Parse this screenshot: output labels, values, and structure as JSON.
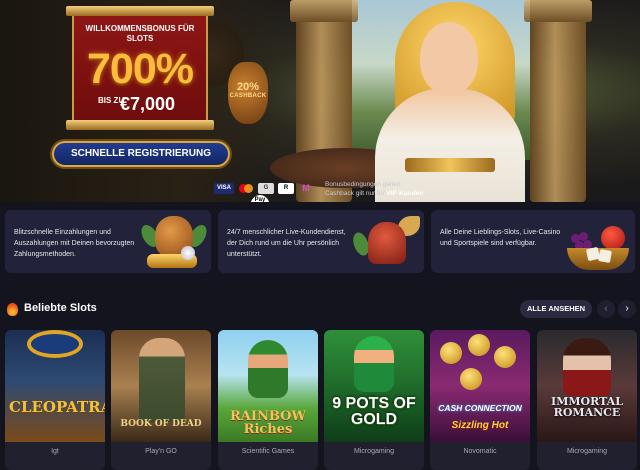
{
  "hero": {
    "bonus_title": "WILLKOMMENSBONUS FÜR SLOTS",
    "bonus_percent": "700%",
    "bonus_upto": "BIS ZU",
    "bonus_amount": "€7,000",
    "cashback_badge_percent": "20%",
    "cashback_badge_label": "CASHBACK",
    "register_button": "SCHNELLE REGISTRIERUNG",
    "payment_methods": [
      "VISA",
      "mastercard",
      "Apple Pay",
      "G",
      "R",
      "M"
    ],
    "terms_line1": "Bonusbedingungen gelten.",
    "terms_line2_prefix": "Cashback gilt nur für ",
    "terms_line2_bold": "VIP-Kunden",
    "terms_line2_suffix": "."
  },
  "features": [
    {
      "text": "Blitzschnelle Einzahlungen und Auszahlungen mit Deinen bevorzugten Zahlungsmethoden.",
      "icon": "amphora-coins-icon"
    },
    {
      "text": "24/7 menschlicher Live-Kundendienst, der Dich rund um die Uhr persönlich unterstützt.",
      "icon": "winged-helmet-icon"
    },
    {
      "text": "Alle Deine Lieblings-Slots, Live-Casino und Sportspiele sind verfügbar.",
      "icon": "fruit-bowl-dice-icon"
    }
  ],
  "section": {
    "title": "Beliebte Slots",
    "icon": "fire-icon",
    "see_all": "ALLE ANSEHEN",
    "prev_icon": "‹",
    "next_icon": "›"
  },
  "games": [
    {
      "title": "CLEOPATRA",
      "provider": "Igt"
    },
    {
      "title": "BOOK OF DEAD",
      "provider": "Play'n GO"
    },
    {
      "title": "RAINBOW Riches",
      "provider": "Scientific Games"
    },
    {
      "title": "9 POTS OF GOLD",
      "provider": "Microgaming"
    },
    {
      "title": "CASH CONNECTION",
      "subtitle": "Sizzling Hot",
      "provider": "Novomatic"
    },
    {
      "title": "IMMORTAL ROMANCE",
      "provider": "Microgaming"
    }
  ],
  "colors": {
    "background": "#14141f",
    "card": "#22223a",
    "accent_gold": "#d8a845",
    "register_blue": "#213b8f"
  }
}
